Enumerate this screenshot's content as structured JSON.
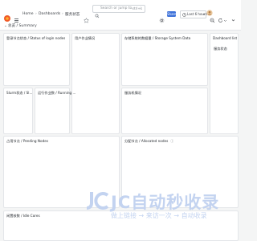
{
  "breadcrumb": {
    "home": "Home",
    "dashboards": "Dashboards",
    "current": "服务状态"
  },
  "search": {
    "placeholder": "Search or jump to...",
    "shortcut": "ctrl+k"
  },
  "toolbar": {
    "share_label": "Share",
    "time_range": "Last 6 hours",
    "icons": [
      "plus-icon",
      "help-icon",
      "news-icon",
      "avatar-icon",
      "zoom-out-icon",
      "refresh-icon",
      "more-icon"
    ]
  },
  "row": {
    "title": "总览 / Summary"
  },
  "panels": {
    "status_login": "登录节点状态 / Status of login nodes",
    "user_jobs": "用户作业情况",
    "storage": "存储系统的数据量 / Storage System Data",
    "dashboard_list": "Dashboard list",
    "dashboard_list_item": "服务状态",
    "slurm_status": "Slurm状态 / Sl...",
    "running_jobs": "运行作业数 / Running ...",
    "service_status": "服务机情况",
    "pending_nodes": "占用节点 / Pending Nodes",
    "allocated_nodes": "分配节点 / Allocated nodes",
    "idle_cores": "闲置核数 / Idle Cores"
  },
  "watermark": {
    "title": "JC自动秒收录",
    "subtitle": "做上链接 → 来访一次 → 自动收录"
  },
  "colors": {
    "accent": "#3d71d9",
    "logo": "#f05a28",
    "panel_bg": "#ffffff",
    "page_bg": "#f4f5f5"
  }
}
